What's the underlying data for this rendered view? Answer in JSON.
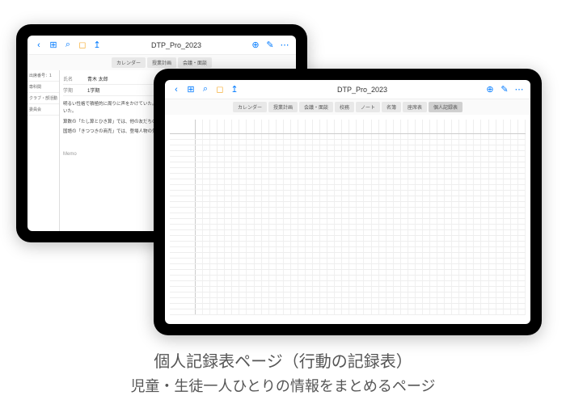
{
  "doc_title": "DTP_Pro_2023",
  "left_tablet": {
    "tabs": [
      "カレンダー",
      "授業計画",
      "会議・面談"
    ],
    "sidebar": [
      "出席番号：1",
      "専科関",
      "クラブ・部活動",
      "委員会"
    ],
    "student_label": "氏名",
    "student_name": "青木 太郎",
    "class_label": "学期",
    "class_val": "1学期",
    "notes": [
      "明るい性格で積極的に周りに声をかけていた。休み時間には自ら声をかけ、外で友達と鬼ごっこなどをして遊んでいた。",
      "算数の「たし算とひき算」では、他の友だちの意見をまとめ、グループで共有できた。",
      "国語の「きつつきの商売」では、登場人物の気持ちを叙述から読み取り、発表にまとめることができた。"
    ],
    "memo_label": "Memo"
  },
  "right_tablet": {
    "tabs": [
      "カレンダー",
      "授業計画",
      "会議・面談",
      "校務",
      "ノート",
      "名簿",
      "座席表",
      "個人記録表"
    ],
    "active_tab": 7
  },
  "caption": {
    "line1": "個人記録表ページ（行動の記録表）",
    "line2": "児童・生徒一人ひとりの情報をまとめるページ"
  }
}
